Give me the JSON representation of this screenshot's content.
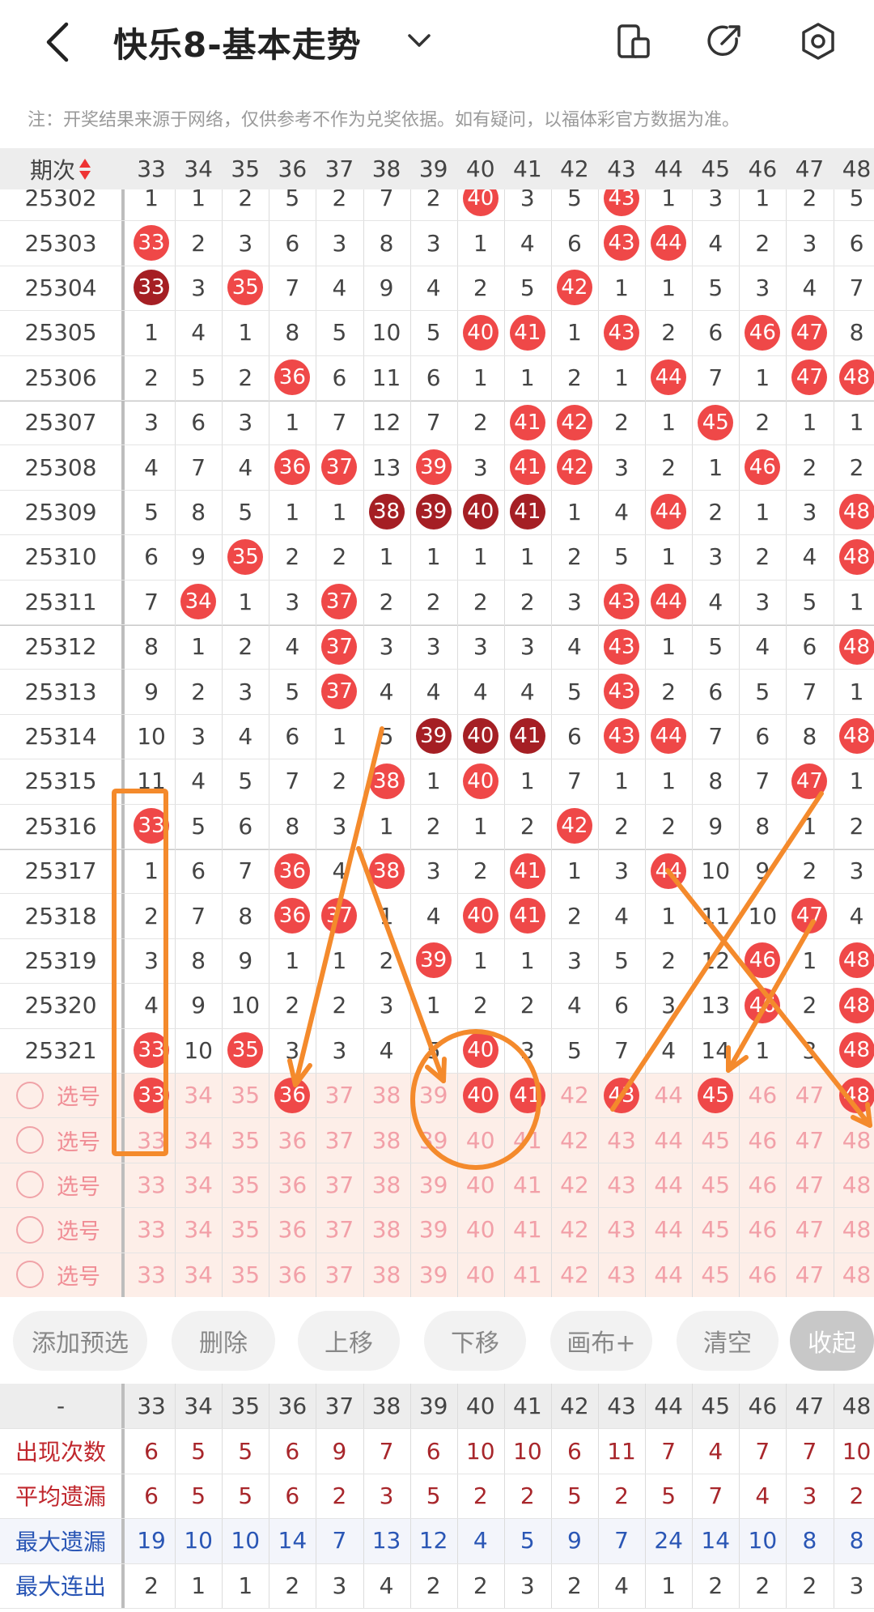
{
  "header": {
    "title": "快乐8-基本走势",
    "back_icon": "chevron-left-icon",
    "dropdown_icon": "chevron-down-icon",
    "icons": [
      "device-icon",
      "share-icon",
      "settings-icon"
    ]
  },
  "note": "注：开奖结果来源于网络，仅供参考不作为兑奖依据。如有疑问，以福体彩官方数据为准。",
  "table": {
    "period_header": "期次",
    "columns": [
      "33",
      "34",
      "35",
      "36",
      "37",
      "38",
      "39",
      "40",
      "41",
      "42",
      "43",
      "44",
      "45",
      "46",
      "47",
      "48"
    ],
    "rows": [
      {
        "period": "25302",
        "cells": [
          "1",
          "1",
          "2",
          "5",
          "2",
          "7",
          "2",
          "40",
          "3",
          "5",
          "43",
          "1",
          "3",
          "1",
          "2",
          "5"
        ]
      },
      {
        "period": "25303",
        "cells": [
          "33",
          "2",
          "3",
          "6",
          "3",
          "8",
          "3",
          "1",
          "4",
          "6",
          "43",
          "44",
          "4",
          "2",
          "3",
          "6"
        ]
      },
      {
        "period": "25304",
        "cells": [
          "33",
          "3",
          "35",
          "7",
          "4",
          "9",
          "4",
          "2",
          "5",
          "42",
          "1",
          "1",
          "5",
          "3",
          "4",
          "7"
        ]
      },
      {
        "period": "25305",
        "cells": [
          "1",
          "4",
          "1",
          "8",
          "5",
          "10",
          "5",
          "40",
          "41",
          "1",
          "43",
          "2",
          "6",
          "46",
          "47",
          "8"
        ]
      },
      {
        "period": "25306",
        "cells": [
          "2",
          "5",
          "2",
          "36",
          "6",
          "11",
          "6",
          "1",
          "1",
          "2",
          "1",
          "44",
          "7",
          "1",
          "47",
          "48"
        ]
      },
      {
        "period": "25307",
        "cells": [
          "3",
          "6",
          "3",
          "1",
          "7",
          "12",
          "7",
          "2",
          "41",
          "42",
          "2",
          "1",
          "45",
          "2",
          "1",
          "1"
        ]
      },
      {
        "period": "25308",
        "cells": [
          "4",
          "7",
          "4",
          "36",
          "37",
          "13",
          "39",
          "3",
          "41",
          "42",
          "3",
          "2",
          "1",
          "46",
          "2",
          "2"
        ]
      },
      {
        "period": "25309",
        "cells": [
          "5",
          "8",
          "5",
          "1",
          "1",
          "38",
          "39",
          "40",
          "41",
          "1",
          "4",
          "44",
          "2",
          "1",
          "3",
          "48"
        ]
      },
      {
        "period": "25310",
        "cells": [
          "6",
          "9",
          "35",
          "2",
          "2",
          "1",
          "1",
          "1",
          "1",
          "2",
          "5",
          "1",
          "3",
          "2",
          "4",
          "48"
        ]
      },
      {
        "period": "25311",
        "cells": [
          "7",
          "34",
          "1",
          "3",
          "37",
          "2",
          "2",
          "2",
          "2",
          "3",
          "43",
          "44",
          "4",
          "3",
          "5",
          "1"
        ]
      },
      {
        "period": "25312",
        "cells": [
          "8",
          "1",
          "2",
          "4",
          "37",
          "3",
          "3",
          "3",
          "3",
          "4",
          "43",
          "1",
          "5",
          "4",
          "6",
          "48"
        ]
      },
      {
        "period": "25313",
        "cells": [
          "9",
          "2",
          "3",
          "5",
          "37",
          "4",
          "4",
          "4",
          "4",
          "5",
          "43",
          "2",
          "6",
          "5",
          "7",
          "1"
        ]
      },
      {
        "period": "25314",
        "cells": [
          "10",
          "3",
          "4",
          "6",
          "1",
          "5",
          "39",
          "40",
          "41",
          "6",
          "43",
          "44",
          "7",
          "6",
          "8",
          "48"
        ]
      },
      {
        "period": "25315",
        "cells": [
          "11",
          "4",
          "5",
          "7",
          "2",
          "38",
          "1",
          "40",
          "1",
          "7",
          "1",
          "1",
          "8",
          "7",
          "47",
          "1"
        ]
      },
      {
        "period": "25316",
        "cells": [
          "33",
          "5",
          "6",
          "8",
          "3",
          "1",
          "2",
          "1",
          "2",
          "42",
          "2",
          "2",
          "9",
          "8",
          "1",
          "2"
        ]
      },
      {
        "period": "25317",
        "cells": [
          "1",
          "6",
          "7",
          "36",
          "4",
          "38",
          "3",
          "2",
          "41",
          "1",
          "3",
          "44",
          "10",
          "9",
          "2",
          "3"
        ]
      },
      {
        "period": "25318",
        "cells": [
          "2",
          "7",
          "8",
          "36",
          "37",
          "1",
          "4",
          "40",
          "41",
          "2",
          "4",
          "1",
          "11",
          "10",
          "47",
          "4"
        ]
      },
      {
        "period": "25319",
        "cells": [
          "3",
          "8",
          "9",
          "1",
          "1",
          "2",
          "39",
          "1",
          "1",
          "3",
          "5",
          "2",
          "12",
          "46",
          "1",
          "48"
        ]
      },
      {
        "period": "25320",
        "cells": [
          "4",
          "9",
          "10",
          "2",
          "2",
          "3",
          "1",
          "2",
          "2",
          "4",
          "6",
          "3",
          "13",
          "46",
          "2",
          "48"
        ]
      },
      {
        "period": "25321",
        "cells": [
          "33",
          "10",
          "35",
          "3",
          "3",
          "4",
          "5",
          "40",
          "3",
          "5",
          "7",
          "4",
          "14",
          "1",
          "3",
          "48"
        ]
      }
    ],
    "dark_balls": [
      [
        2,
        0
      ],
      [
        7,
        5
      ],
      [
        7,
        6
      ],
      [
        7,
        7
      ],
      [
        7,
        8
      ],
      [
        12,
        6
      ],
      [
        12,
        7
      ],
      [
        12,
        8
      ]
    ],
    "select_label": "选号",
    "select_rows": [
      {
        "selected": [
          "33",
          "36",
          "40",
          "41",
          "43",
          "45",
          "48"
        ]
      },
      {
        "selected": []
      },
      {
        "selected": []
      },
      {
        "selected": []
      },
      {
        "selected": []
      }
    ]
  },
  "toolbar": {
    "buttons": [
      "添加预选",
      "删除",
      "上移",
      "下移",
      "画布+",
      "清空",
      "收起"
    ]
  },
  "stats": {
    "header_label": "-",
    "rows": [
      {
        "label": "出现次数",
        "color": "red",
        "values": [
          "6",
          "5",
          "5",
          "6",
          "9",
          "7",
          "6",
          "10",
          "10",
          "6",
          "11",
          "7",
          "4",
          "7",
          "7",
          "10"
        ]
      },
      {
        "label": "平均遗漏",
        "color": "red",
        "values": [
          "6",
          "5",
          "5",
          "6",
          "2",
          "3",
          "5",
          "2",
          "2",
          "5",
          "2",
          "5",
          "7",
          "4",
          "3",
          "2"
        ]
      },
      {
        "label": "最大遗漏",
        "color": "blue",
        "values": [
          "19",
          "10",
          "10",
          "14",
          "7",
          "13",
          "12",
          "4",
          "5",
          "9",
          "7",
          "24",
          "14",
          "10",
          "8",
          "8"
        ]
      },
      {
        "label": "最大连出",
        "color": "dark",
        "values": [
          "2",
          "1",
          "1",
          "2",
          "3",
          "4",
          "2",
          "2",
          "3",
          "2",
          "4",
          "1",
          "2",
          "2",
          "2",
          "3"
        ]
      }
    ]
  },
  "colors": {
    "ball": "#ef4848",
    "ball_dark": "#a51f24",
    "select_bg": "#fdeee8",
    "annotation": "#f48a2c"
  }
}
